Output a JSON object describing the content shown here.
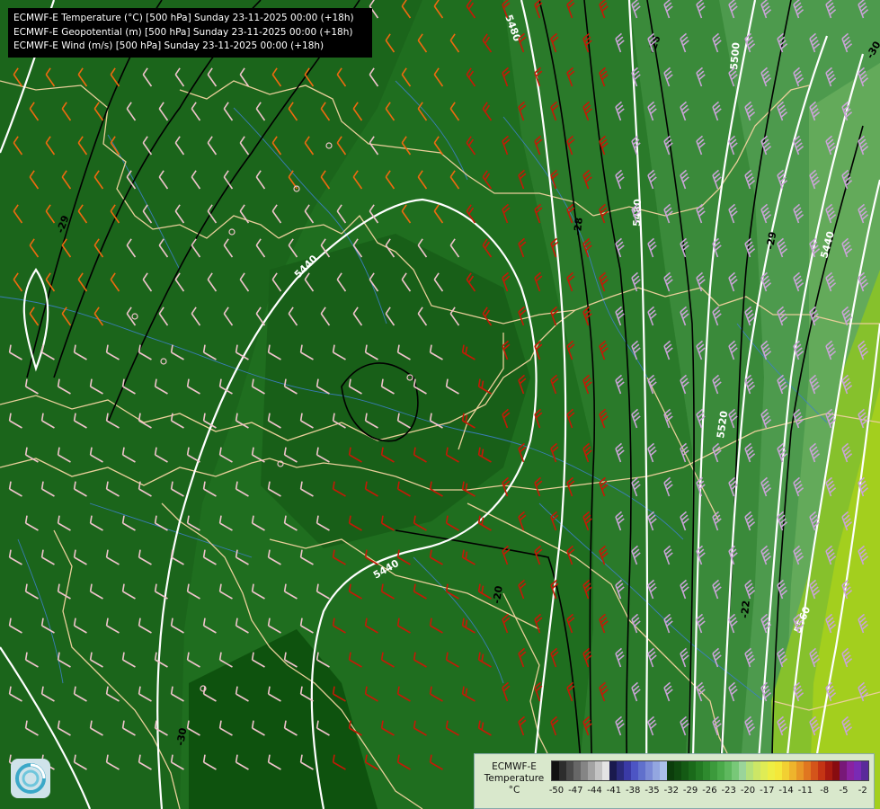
{
  "header": {
    "lines": [
      "ECMWF-E Temperature (°C) [500 hPa] Sunday 23-11-2025 00:00 (+18h)",
      "ECMWF-E Geopotential (m) [500 hPa] Sunday 23-11-2025 00:00 (+18h)",
      "ECMWF-E Wind (m/s) [500 hPa] Sunday 23-11-2025 00:00 (+18h)"
    ]
  },
  "legend": {
    "title_lines": [
      "ECMWF-E",
      "Temperature",
      "°C"
    ],
    "ticks": [
      "-50",
      "-47",
      "-44",
      "-41",
      "-38",
      "-35",
      "-32",
      "-29",
      "-26",
      "-23",
      "-20",
      "-17",
      "-14",
      "-11",
      "-8",
      "-5",
      "-2"
    ],
    "colors": [
      "#111111",
      "#2d2d2d",
      "#4a4a4a",
      "#676767",
      "#858585",
      "#a3a3a3",
      "#c4c4c4",
      "#e4e4e4",
      "#1a1a4e",
      "#2a2a7a",
      "#3a3aa6",
      "#4d55c4",
      "#6070cc",
      "#7a8ad6",
      "#93a6e0",
      "#aac0ea",
      "#0b3d0b",
      "#0f4a0f",
      "#145a14",
      "#1a6a1a",
      "#237a23",
      "#2e8a2e",
      "#3c9a3c",
      "#4aaa4a",
      "#5eb85e",
      "#78c878",
      "#9ad49a",
      "#b4e07a",
      "#cce666",
      "#dfec55",
      "#eeee44",
      "#f4e83a",
      "#f2d032",
      "#eeb42c",
      "#e89626",
      "#e07620",
      "#d4541a",
      "#c43414",
      "#a81a10",
      "#880c10",
      "#781878",
      "#8a22a0",
      "#7a2ab4",
      "#5a2a9a"
    ]
  },
  "contour_labels": {
    "geopotential": [
      "5480",
      "5500",
      "5480",
      "5440",
      "5440",
      "5520",
      "5440",
      "5560"
    ],
    "temperature": [
      "-26",
      "-29",
      "-29",
      "-30",
      "-20",
      "-28",
      "-22",
      "-30"
    ]
  },
  "colors": {
    "geopotential_line": "#ffffff",
    "temperature_line": "#000000",
    "border_line": "#e9cf9a",
    "river_line": "#3d80c8",
    "barb_pink": "#f0c4cc",
    "barb_orange": "#ee6a10",
    "barb_red": "#c41a06",
    "barb_lilac": "#c9a4d6"
  }
}
